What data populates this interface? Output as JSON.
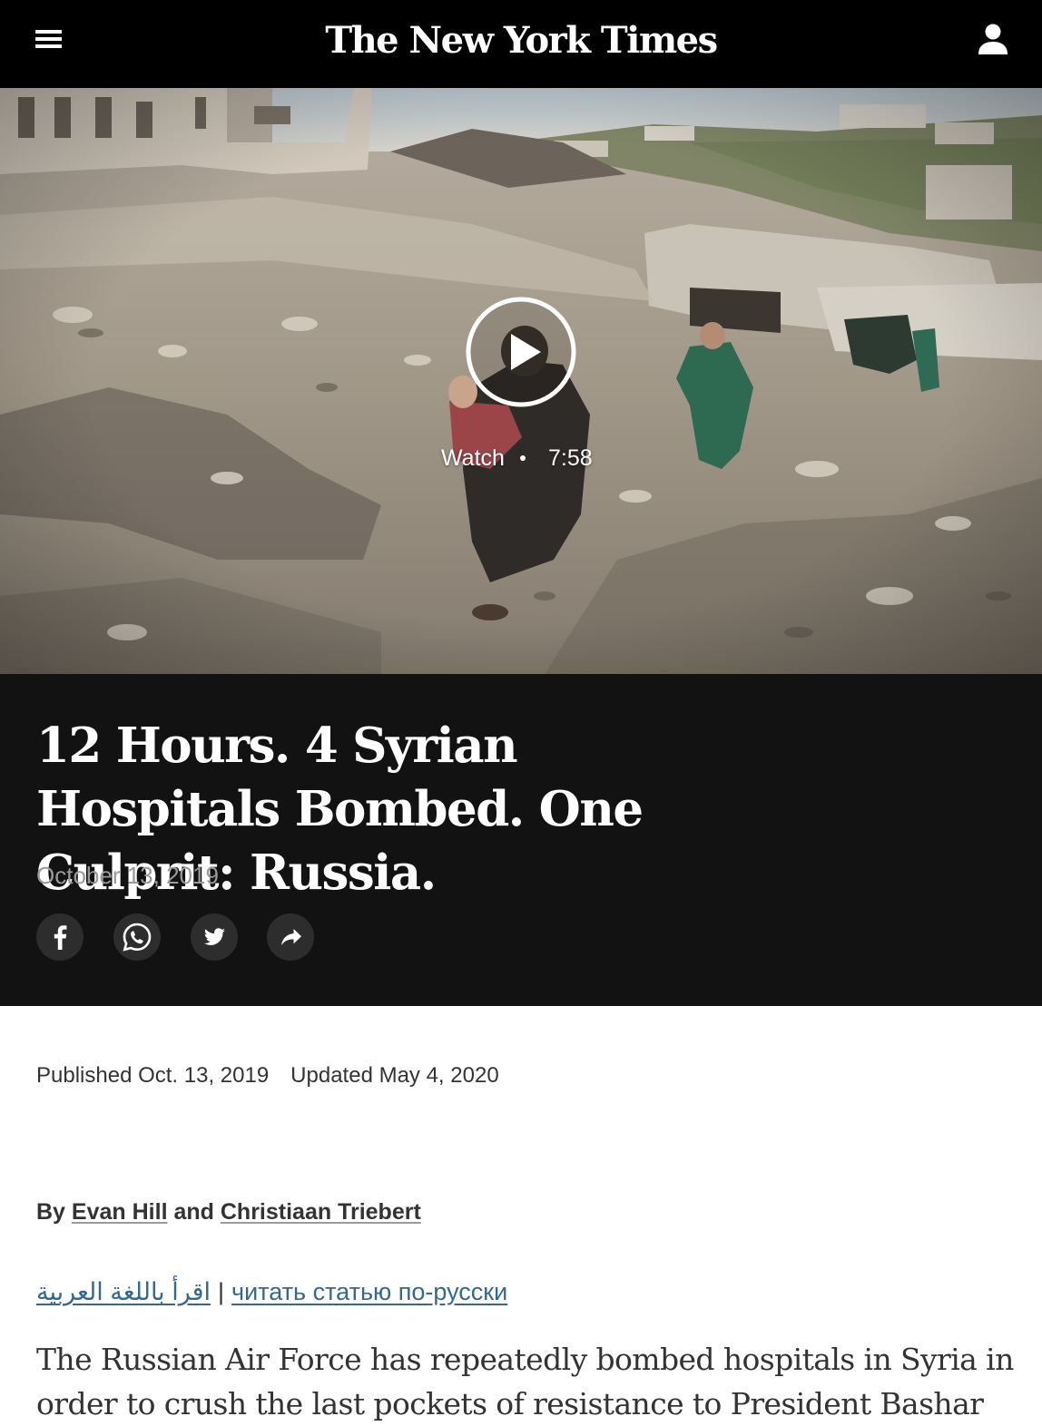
{
  "header": {
    "logo_text": "The New York Times",
    "menu_icon": "hamburger-menu-icon",
    "account_icon": "user-account-icon",
    "background_color": "#000000"
  },
  "video": {
    "watch_label": "Watch",
    "duration": "7:58",
    "play_icon": "play-icon"
  },
  "article": {
    "headline": "12 Hours. 4 Syrian Hospitals Bombed. One Culprit: Russia.",
    "date": "October 13, 2019",
    "published": "Published Oct. 13, 2019",
    "updated": "Updated May 4, 2020",
    "byline": {
      "prefix": "By",
      "author1": "Evan Hill",
      "conjunction": "and",
      "author2": "Christiaan Triebert"
    },
    "language_links": {
      "arabic": "اقرأ باللغة العربية",
      "separator": "|",
      "russian": "читать статью по-русски"
    },
    "body_intro": "The Russian Air Force has repeatedly bombed hospitals in Syria in order to crush the last pockets of resistance to President Bashar"
  },
  "share": {
    "buttons": [
      {
        "icon": "facebook-icon"
      },
      {
        "icon": "whatsapp-icon"
      },
      {
        "icon": "twitter-icon"
      },
      {
        "icon": "share-arrow-icon"
      }
    ]
  },
  "colors": {
    "title_block_bg": "#121212",
    "link_blue": "#326891",
    "body_text": "#333333"
  }
}
